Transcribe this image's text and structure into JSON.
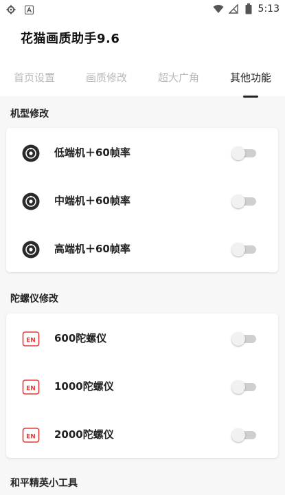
{
  "status_bar": {
    "time": "5:13",
    "left_icons": [
      "settings-icon",
      "app-a-icon"
    ],
    "right_icons": [
      "wifi-icon",
      "no-sim-icon",
      "battery-icon"
    ]
  },
  "app": {
    "title": "花猫画质助手9.6"
  },
  "tabs": [
    {
      "label": "首页设置",
      "active": false
    },
    {
      "label": "画质修改",
      "active": false
    },
    {
      "label": "超大广角",
      "active": false
    },
    {
      "label": "其他功能",
      "active": true
    }
  ],
  "sections": [
    {
      "title": "机型修改",
      "items": [
        {
          "label": "低端机＋60帧率",
          "icon": "camera-aperture-icon",
          "enabled": false
        },
        {
          "label": "中端机＋60帧率",
          "icon": "camera-aperture-icon",
          "enabled": false
        },
        {
          "label": "高端机＋60帧率",
          "icon": "camera-aperture-icon",
          "enabled": false
        }
      ]
    },
    {
      "title": "陀螺仪修改",
      "items": [
        {
          "label": "600陀螺仪",
          "icon": "en-badge-icon",
          "icon_text": "EN",
          "enabled": false
        },
        {
          "label": "1000陀螺仪",
          "icon": "en-badge-icon",
          "icon_text": "EN",
          "enabled": false
        },
        {
          "label": "2000陀螺仪",
          "icon": "en-badge-icon",
          "icon_text": "EN",
          "enabled": false
        }
      ]
    },
    {
      "title": "和平精英小工具",
      "items": []
    }
  ],
  "colors": {
    "background": "#f7f7f7",
    "card": "#ffffff",
    "tab_inactive": "#b9b9b9",
    "tab_active": "#222222",
    "en_badge": "#e53935",
    "toggle_track": "#cfcfcf",
    "toggle_thumb": "#f1f1f1"
  }
}
